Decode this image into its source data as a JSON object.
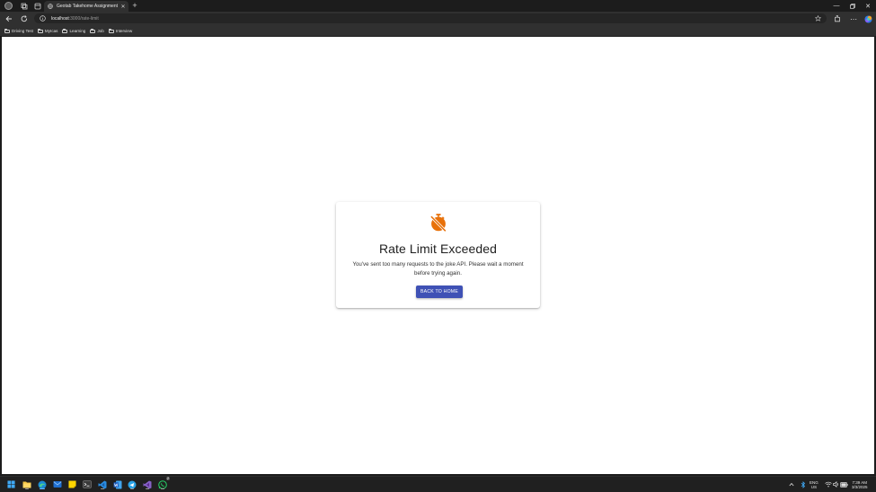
{
  "browser": {
    "tab": {
      "title": "Geotab Takehome Assignment"
    },
    "url": {
      "host": "localhost",
      "path": ":3000/rate-limit"
    },
    "bookmarks": [
      {
        "label": "Driving Test"
      },
      {
        "label": "MyIcas"
      },
      {
        "label": "Learning"
      },
      {
        "label": "Job"
      },
      {
        "label": "Interview"
      }
    ]
  },
  "page": {
    "icon": "alarm-off-icon",
    "icon_color": "#e8710a",
    "title": "Rate Limit Exceeded",
    "message_line1": "You've sent too many requests to the joke API. Please wait a moment",
    "message_line2": "before trying again.",
    "button_label": "BACK TO HOME",
    "button_color": "#3f51b5"
  },
  "taskbar": {
    "language": "ENG",
    "region": "US",
    "time": "7:39 AM",
    "date": "3/3/2025",
    "whatsapp_badge": "2"
  }
}
